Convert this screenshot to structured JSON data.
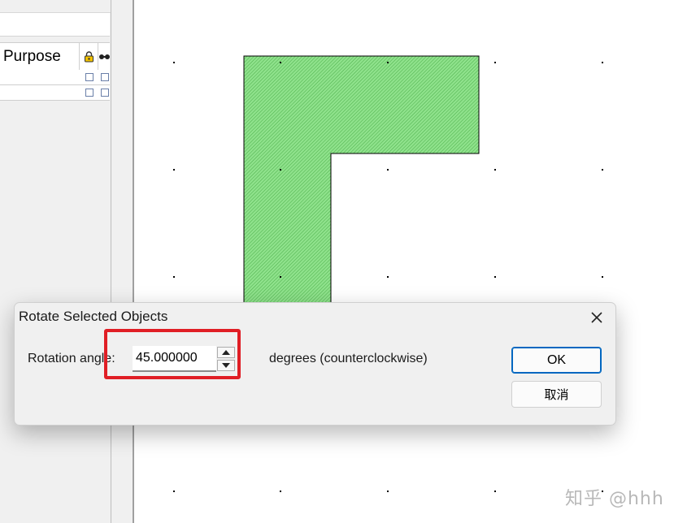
{
  "layer_panel": {
    "column_purpose": "Purpose",
    "lock_icon": "lock-icon",
    "visibility_icon": "visibility-icon",
    "rows": [
      {
        "checkbox_icon": "checkbox-icon"
      },
      {
        "checkbox_icon": "checkbox-icon"
      }
    ]
  },
  "canvas": {
    "shape_color": "#8fe28c",
    "shape_stroke": "#000000"
  },
  "dialog": {
    "title": "Rotate Selected Objects",
    "close_icon": "close-icon",
    "rotation_label": "Rotation angle:",
    "angle_value": "45.000000",
    "spin_up_icon": "spin-up-icon",
    "spin_down_icon": "spin-down-icon",
    "degrees_label": "degrees (counterclockwise)",
    "ok_label": "OK",
    "cancel_label": "取消",
    "highlight_color": "#e01e25"
  },
  "watermark": "知乎 @hhh"
}
